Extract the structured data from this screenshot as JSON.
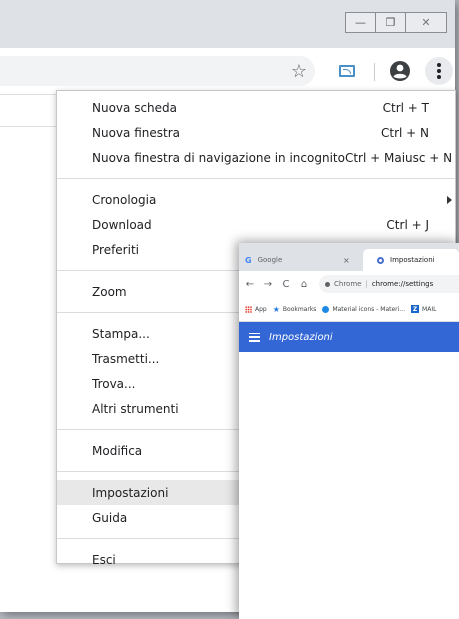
{
  "window": {
    "minimize_glyph": "—",
    "maximize_glyph": "❐",
    "close_glyph": "✕"
  },
  "toolbar": {
    "bookmark_icon": "star-icon",
    "cast_icon": "cast-icon",
    "profile_icon": "account-circle-icon",
    "menu_icon": "more-vert-icon",
    "star_glyph": "☆"
  },
  "menu": {
    "items": [
      {
        "label": "Nuova scheda",
        "shortcut": "Ctrl + T"
      },
      {
        "label": "Nuova finestra",
        "shortcut": "Ctrl + N"
      },
      {
        "label": "Nuova finestra di navigazione in incognito",
        "shortcut": "Ctrl + Maiusc + N"
      },
      {
        "label": "Cronologia",
        "shortcut": ""
      },
      {
        "label": "Download",
        "shortcut": "Ctrl + J"
      },
      {
        "label": "Preferiti",
        "shortcut": ""
      },
      {
        "label": "Zoom",
        "shortcut": ""
      },
      {
        "label": "Stampa...",
        "shortcut": ""
      },
      {
        "label": "Trasmetti...",
        "shortcut": ""
      },
      {
        "label": "Trova...",
        "shortcut": ""
      },
      {
        "label": "Altri strumenti",
        "shortcut": ""
      },
      {
        "label": "Modifica",
        "shortcut": ""
      },
      {
        "label": "Impostazioni",
        "shortcut": ""
      },
      {
        "label": "Guida",
        "shortcut": ""
      },
      {
        "label": "Esci",
        "shortcut": ""
      }
    ],
    "selected_item": "Impostazioni"
  },
  "preview": {
    "tabs": [
      {
        "label": "Google",
        "icon": "google-g-icon"
      },
      {
        "label": "Impostazioni",
        "icon": "gear-icon"
      }
    ],
    "tab_close_glyph": "×",
    "google_g": "G",
    "nav": {
      "back": "←",
      "forward": "→",
      "reload": "C",
      "home": "⌂"
    },
    "url": {
      "origin": "Chrome",
      "path": "chrome://settings",
      "separator": "|"
    },
    "bookmarks": [
      {
        "label": "App"
      },
      {
        "label": "Bookmarks"
      },
      {
        "label": "Material icons - Materi..."
      },
      {
        "label": "MAIL"
      }
    ],
    "bookmark_z_glyph": "Z",
    "header_title": "Impostazioni"
  },
  "colors": {
    "settings_header": "#3367d6",
    "menu_selected": "#e8e8e8",
    "frame": "#dee1e6"
  }
}
